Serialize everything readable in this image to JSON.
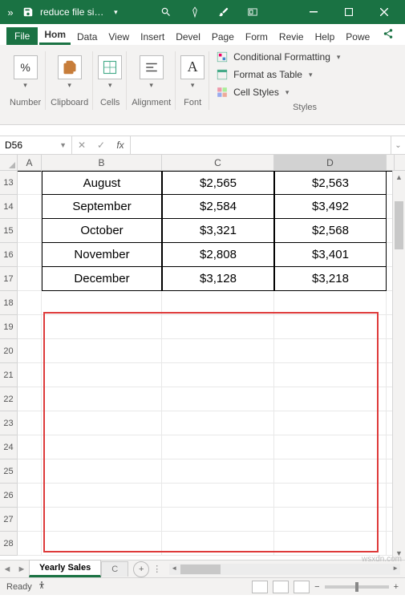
{
  "title": {
    "filename": "reduce file si…"
  },
  "menu": {
    "file": "File",
    "home": "Hom",
    "data": "Data",
    "view": "View",
    "insert": "Insert",
    "devel": "Devel",
    "page": "Page",
    "form": "Form",
    "revie": "Revie",
    "help": "Help",
    "powe": "Powe"
  },
  "ribbon": {
    "number": {
      "label": "Number",
      "icon": "%"
    },
    "clipboard": {
      "label": "Clipboard"
    },
    "cells": {
      "label": "Cells"
    },
    "alignment": {
      "label": "Alignment"
    },
    "font": {
      "label": "Font"
    },
    "styles": {
      "label": "Styles",
      "cond": "Conditional Formatting",
      "table": "Format as Table",
      "cell": "Cell Styles"
    }
  },
  "namebox": "D56",
  "columns": {
    "A": "A",
    "B": "B",
    "C": "C",
    "D": "D"
  },
  "rownums": [
    "13",
    "14",
    "15",
    "16",
    "17",
    "18",
    "19",
    "20",
    "21",
    "22",
    "23",
    "24",
    "25",
    "26",
    "27",
    "28"
  ],
  "table": [
    {
      "month": "August",
      "c": "$2,565",
      "d": "$2,563"
    },
    {
      "month": "September",
      "c": "$2,584",
      "d": "$3,492"
    },
    {
      "month": "October",
      "c": "$3,321",
      "d": "$2,568"
    },
    {
      "month": "November",
      "c": "$2,808",
      "d": "$3,401"
    },
    {
      "month": "December",
      "c": "$3,128",
      "d": "$3,218"
    }
  ],
  "sheets": {
    "active": "Yearly Sales",
    "next": "C",
    "addTip": "+"
  },
  "status": {
    "ready": "Ready",
    "zoomMinus": "−",
    "zoomPlus": "+"
  },
  "watermark": "wsxdn.com"
}
